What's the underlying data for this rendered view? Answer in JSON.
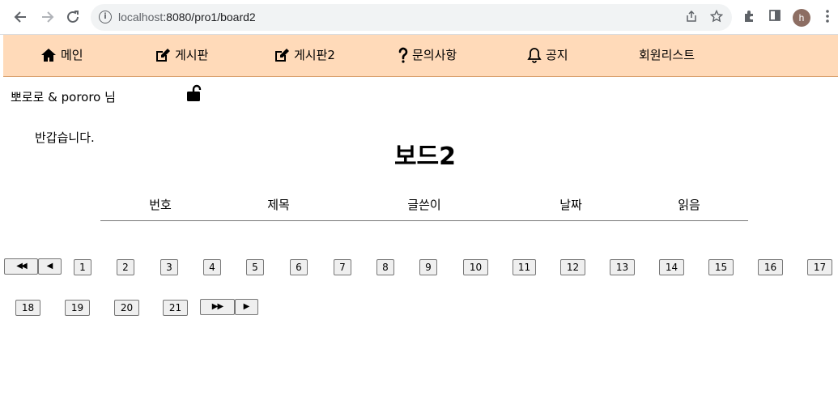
{
  "browser": {
    "url_host": "localhost",
    "url_path": ":8080/pro1/board2",
    "profile_initial": "h"
  },
  "nav": {
    "items": [
      {
        "label": "메인",
        "icon": "home-icon"
      },
      {
        "label": "게시판",
        "icon": "edit-icon"
      },
      {
        "label": "게시판2",
        "icon": "edit-icon"
      },
      {
        "label": "문의사항",
        "icon": "question-icon"
      },
      {
        "label": "공지",
        "icon": "bell-icon"
      },
      {
        "label": "회원리스트",
        "icon": ""
      }
    ]
  },
  "user": {
    "greeting": "뽀로로 & pororo 님",
    "welcome": "반갑습니다.",
    "lock_icon": "unlock-icon"
  },
  "board": {
    "title": "보드2",
    "columns": [
      "번호",
      "제목",
      "글쓴이",
      "날짜",
      "읽음"
    ]
  },
  "pagination": {
    "first_label": "◀◀",
    "prev_label": "◀",
    "pages": [
      "1",
      "2",
      "3",
      "4",
      "5",
      "6",
      "7",
      "8",
      "9",
      "10",
      "11",
      "12",
      "13",
      "14",
      "15",
      "16",
      "17",
      "18",
      "19",
      "20",
      "21"
    ],
    "next_last_label": "▶▶",
    "next_label": "▶"
  }
}
